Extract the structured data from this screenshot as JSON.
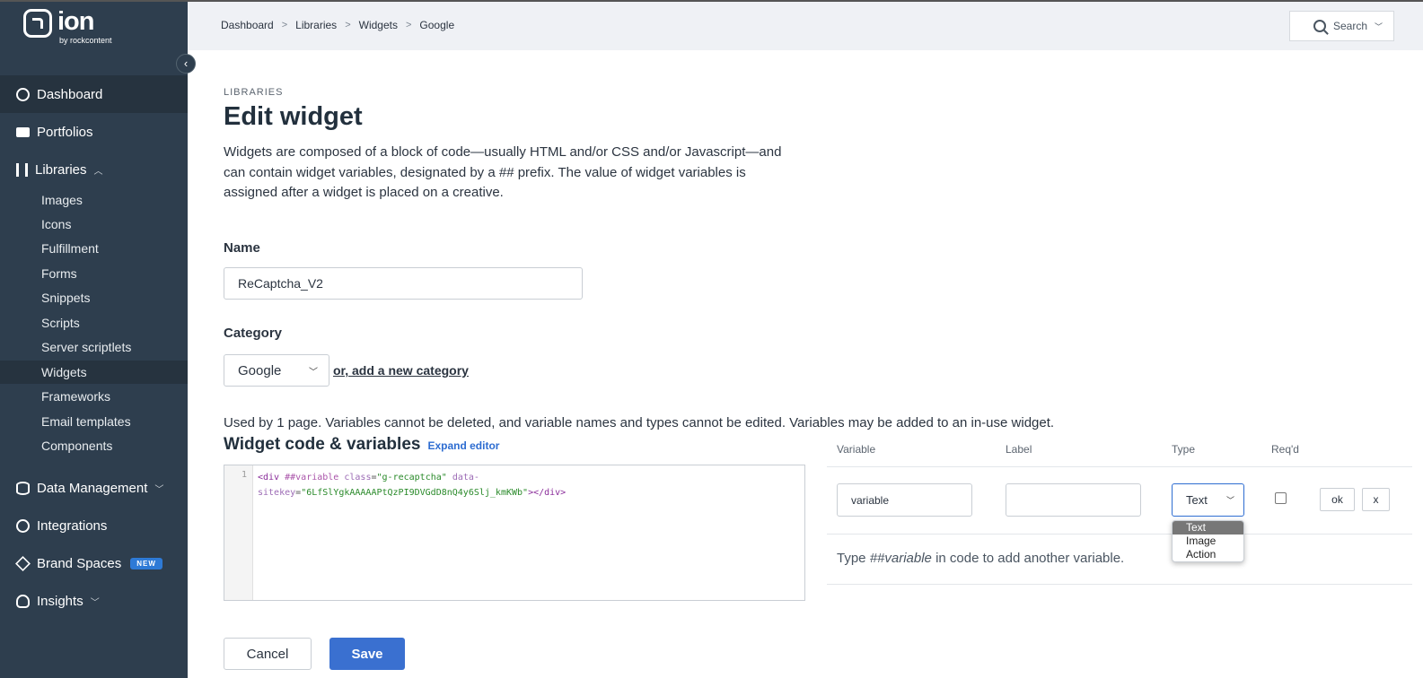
{
  "brand": {
    "name": "ion",
    "sub": "by rockcontent"
  },
  "sidebar": {
    "main_items": [
      {
        "label": "Dashboard",
        "icon": "user-circle-icon"
      },
      {
        "label": "Portfolios",
        "icon": "folder-icon"
      },
      {
        "label": "Libraries",
        "icon": "books-icon",
        "expanded": true
      },
      {
        "label": "Data Management",
        "icon": "database-icon"
      },
      {
        "label": "Integrations",
        "icon": "globe-icon"
      },
      {
        "label": "Brand Spaces",
        "icon": "cube-icon",
        "badge": "NEW"
      },
      {
        "label": "Insights",
        "icon": "lightbulb-icon"
      }
    ],
    "library_items": [
      "Images",
      "Icons",
      "Fulfillment",
      "Forms",
      "Snippets",
      "Scripts",
      "Server scriptlets",
      "Widgets",
      "Frameworks",
      "Email templates",
      "Components"
    ],
    "active_library_item": "Widgets"
  },
  "header": {
    "breadcrumb": [
      "Dashboard",
      "Libraries",
      "Widgets",
      "Google"
    ],
    "search_label": "Search"
  },
  "page": {
    "eyebrow": "LIBRARIES",
    "title": "Edit widget",
    "description": "Widgets are composed of a block of code—usually HTML and/or CSS and/or Javascript—and can contain widget variables, designated by a ## prefix. The value of widget variables is assigned after a widget is placed on a creative."
  },
  "form": {
    "name_label": "Name",
    "name_value": "ReCaptcha_V2",
    "category_label": "Category",
    "category_value": "Google",
    "add_category_link": "or, add a new category",
    "usage_note": "Used by 1 page. Variables cannot be deleted, and variable names and types cannot be edited. Variables may be added to an in-use widget.",
    "code_title": "Widget code & variables",
    "expand_editor": "Expand editor",
    "code_line_number": "1",
    "code": {
      "open_tag": "<div",
      "variable": "##variable",
      "attr1": "class",
      "eq1": "=",
      "val1": "\"g-recaptcha\"",
      "attr2_part1": "data-",
      "attr2_part2": "sitekey",
      "eq2": "=",
      "val2": "\"6LfSlYgkAAAAAPtQzPI9DVGdD8nQ4y6Slj_kmKWb\"",
      "close": "></div>"
    }
  },
  "variables_table": {
    "headers": {
      "variable": "Variable",
      "label": "Label",
      "type": "Type",
      "required": "Req'd"
    },
    "row": {
      "variable_value": "variable",
      "label_value": "",
      "type_value": "Text",
      "required": false,
      "ok_label": "ok",
      "x_label": "x"
    },
    "type_options": [
      "Text",
      "Image",
      "Action"
    ],
    "hint_prefix": "Type ",
    "hint_code": "##variable",
    "hint_suffix": " in code to add another variable."
  },
  "actions": {
    "cancel": "Cancel",
    "save": "Save"
  },
  "colors": {
    "sidebar_bg": "#2e3e4e",
    "accent": "#3a70d0",
    "header_bg": "#eff1f5"
  }
}
